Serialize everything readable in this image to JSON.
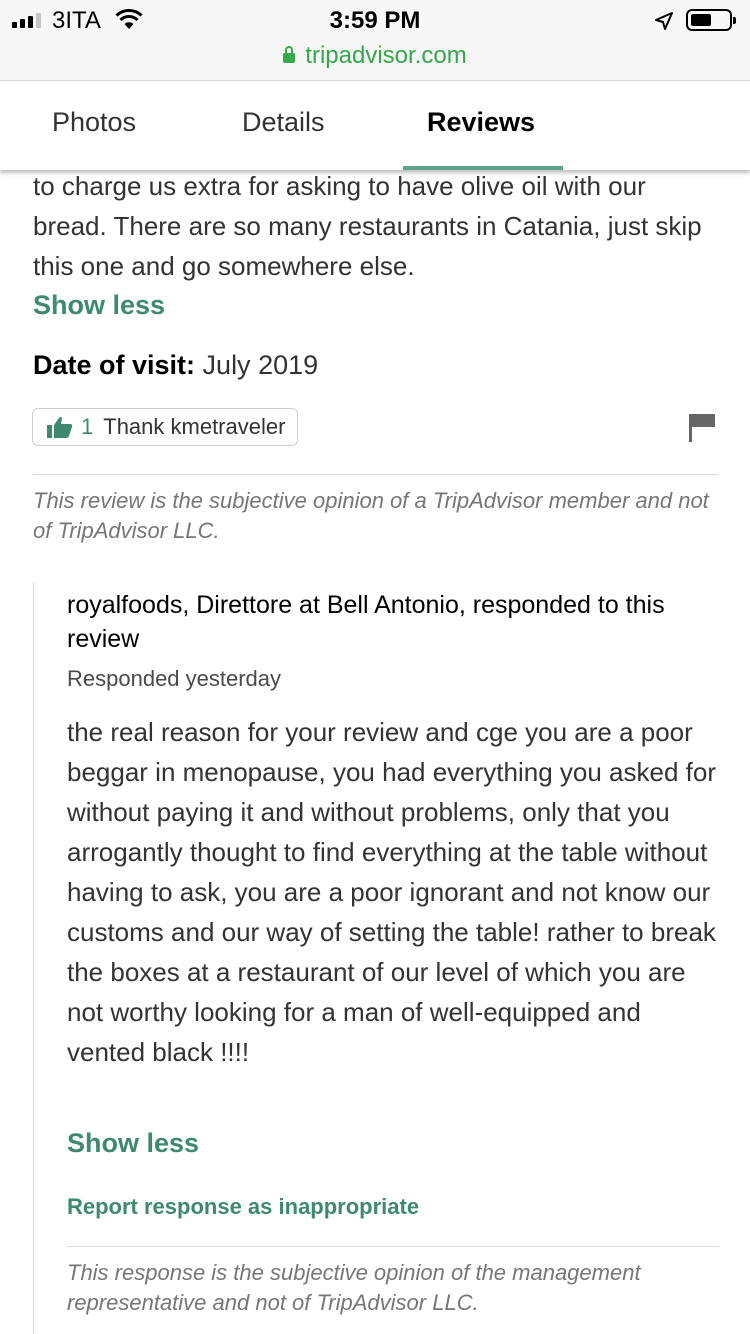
{
  "status_bar": {
    "carrier": "3ITA",
    "time": "3:59 PM"
  },
  "browser": {
    "url": "tripadvisor.com"
  },
  "tabs": [
    {
      "label": "Photos",
      "active": false
    },
    {
      "label": "Details",
      "active": false
    },
    {
      "label": "Reviews",
      "active": true
    }
  ],
  "review": {
    "text": "to charge us extra for asking to have olive oil with our bread. There are so many restaurants in Catania, just skip this one and go somewhere else.",
    "show_less": "Show less",
    "date_label": "Date of visit:",
    "date_value": "July 2019",
    "thank_count": "1",
    "thank_label": "Thank kmetraveler",
    "disclaimer": "This review is the subjective opinion of a TripAdvisor member and not of TripAdvisor LLC."
  },
  "response": {
    "header": "royalfoods, Direttore at Bell Antonio, responded to this review",
    "date": "Responded yesterday",
    "text": "the real reason for your review and cge you are a poor beggar in menopause, you had everything you asked for without paying it and without problems, only that you arrogantly thought to find everything at the table without having to ask, you are a poor ignorant and not know our customs and our way of setting the table! rather to break the boxes at a restaurant of our level of which you are not worthy looking for a man of well-equipped and vented black !!!!",
    "show_less": "Show less",
    "report_link": "Report response as inappropriate",
    "disclaimer": "This response is the subjective opinion of the management representative and not of TripAdvisor LLC."
  },
  "colors": {
    "accent_green": "#3e8a70",
    "url_green": "#34a84a",
    "tab_underline": "#5ba58d"
  }
}
